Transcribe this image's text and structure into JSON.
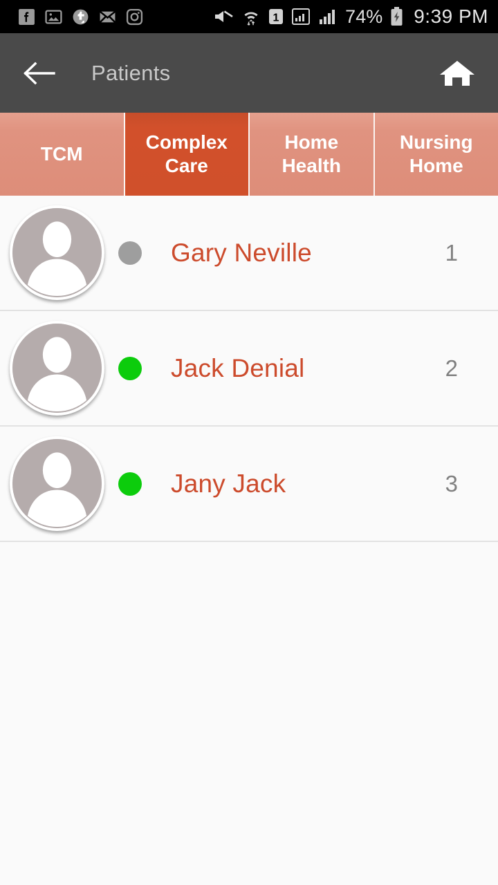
{
  "statusbar": {
    "notification_icons": [
      "facebook-icon",
      "photos-icon",
      "tumblr-icon",
      "email-icon",
      "instagram-icon"
    ],
    "system_icons": [
      "mute-icon",
      "wifi-icon",
      "sim1-icon",
      "signal-boxed-icon",
      "signal-icon"
    ],
    "battery_percent": "74%",
    "battery_state": "charging",
    "time": "9:39 PM"
  },
  "toolbar": {
    "back_label": "back-arrow",
    "title": "Patients",
    "home_label": "home"
  },
  "tabs": {
    "items": [
      {
        "label": "TCM",
        "active": false
      },
      {
        "label": "Complex Care",
        "active": true
      },
      {
        "label": "Home Health",
        "active": false
      },
      {
        "label": "Nursing Home",
        "active": false
      }
    ],
    "active_index": 1,
    "active_color": "#d2502b",
    "inactive_color": "#e09380"
  },
  "patients": {
    "rows": [
      {
        "name": "Gary Neville",
        "number": "1",
        "status": "offline",
        "status_color": "#9e9e9e"
      },
      {
        "name": "Jack Denial",
        "number": "2",
        "status": "online",
        "status_color": "#0ccc0c"
      },
      {
        "name": "Jany Jack",
        "number": "3",
        "status": "online",
        "status_color": "#0ccc0c"
      }
    ]
  },
  "theme": {
    "name_color": "#cc4b2c",
    "number_color": "#808080",
    "toolbar_bg": "#4a4a4a",
    "list_bg": "#fafafa",
    "avatar_bg": "#b5acac"
  }
}
